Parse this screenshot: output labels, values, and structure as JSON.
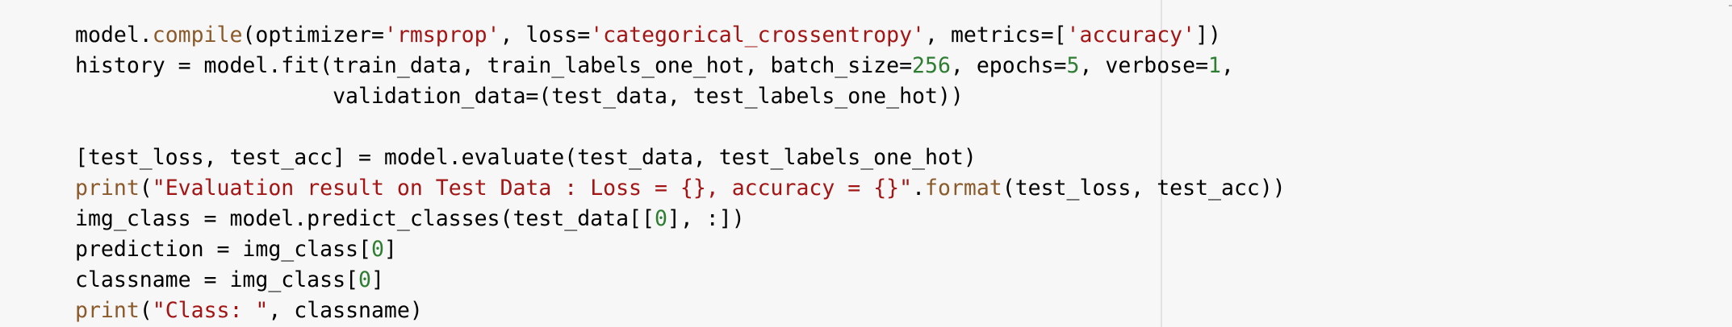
{
  "colors": {
    "background": "#f7f7f7",
    "text": "#000000",
    "function": "#8b5a2b",
    "string": "#a31515",
    "number": "#2e7d32",
    "ruler": "#e2e2e2"
  },
  "code_lines": [
    [
      {
        "t": "model.",
        "k": "plain"
      },
      {
        "t": "compile",
        "k": "func"
      },
      {
        "t": "(optimizer=",
        "k": "plain"
      },
      {
        "t": "'rmsprop'",
        "k": "str"
      },
      {
        "t": ", loss=",
        "k": "plain"
      },
      {
        "t": "'categorical_crossentropy'",
        "k": "str"
      },
      {
        "t": ", metrics=[",
        "k": "plain"
      },
      {
        "t": "'accuracy'",
        "k": "str"
      },
      {
        "t": "])",
        "k": "plain"
      }
    ],
    [
      {
        "t": "history = model.fit(train_data, train_labels_one_hot, batch_size=",
        "k": "plain"
      },
      {
        "t": "256",
        "k": "num"
      },
      {
        "t": ", epochs=",
        "k": "plain"
      },
      {
        "t": "5",
        "k": "num"
      },
      {
        "t": ", verbose=",
        "k": "plain"
      },
      {
        "t": "1",
        "k": "num"
      },
      {
        "t": ",",
        "k": "plain"
      }
    ],
    [
      {
        "t": "                    validation_data=(test_data, test_labels_one_hot))",
        "k": "plain"
      }
    ],
    [],
    [
      {
        "t": "[test_loss, test_acc] = model.evaluate(test_data, test_labels_one_hot)",
        "k": "plain"
      }
    ],
    [
      {
        "t": "print",
        "k": "func"
      },
      {
        "t": "(",
        "k": "plain"
      },
      {
        "t": "\"Evaluation result on Test Data : Loss = {}, accuracy = {}\"",
        "k": "str"
      },
      {
        "t": ".",
        "k": "plain"
      },
      {
        "t": "format",
        "k": "func"
      },
      {
        "t": "(test_loss, test_acc))",
        "k": "plain"
      }
    ],
    [
      {
        "t": "img_class = model.predict_classes(test_data[[",
        "k": "plain"
      },
      {
        "t": "0",
        "k": "num"
      },
      {
        "t": "], :])",
        "k": "plain"
      }
    ],
    [
      {
        "t": "prediction = img_class[",
        "k": "plain"
      },
      {
        "t": "0",
        "k": "num"
      },
      {
        "t": "]",
        "k": "plain"
      }
    ],
    [
      {
        "t": "classname = img_class[",
        "k": "plain"
      },
      {
        "t": "0",
        "k": "num"
      },
      {
        "t": "]",
        "k": "plain"
      }
    ],
    [
      {
        "t": "print",
        "k": "func"
      },
      {
        "t": "(",
        "k": "plain"
      },
      {
        "t": "\"Class: \"",
        "k": "str"
      },
      {
        "t": ", classname)",
        "k": "plain"
      }
    ]
  ]
}
